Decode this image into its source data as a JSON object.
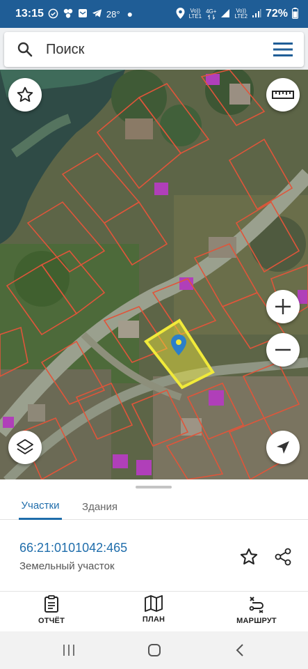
{
  "status_bar": {
    "time": "13:15",
    "temperature": "28°",
    "net1": "Vo))",
    "net1_sub": "LTE1",
    "net2": "4G+",
    "net3": "Vo))",
    "net3_sub": "LTE2",
    "battery": "72%"
  },
  "search": {
    "placeholder": "Поиск"
  },
  "map": {
    "selected_parcel_color": "#f1ea3a",
    "boundary_color": "#e0553a"
  },
  "tabs": {
    "active": "Участки",
    "inactive": "Здания"
  },
  "parcel": {
    "number": "66:21:0101042:465",
    "type": "Земельный участок"
  },
  "bottom_nav": {
    "report": "ОТЧЁТ",
    "plan": "ПЛАН",
    "route": "МАРШРУТ"
  },
  "colors": {
    "status_bar": "#1f5d96",
    "accent": "#1f6dab"
  }
}
